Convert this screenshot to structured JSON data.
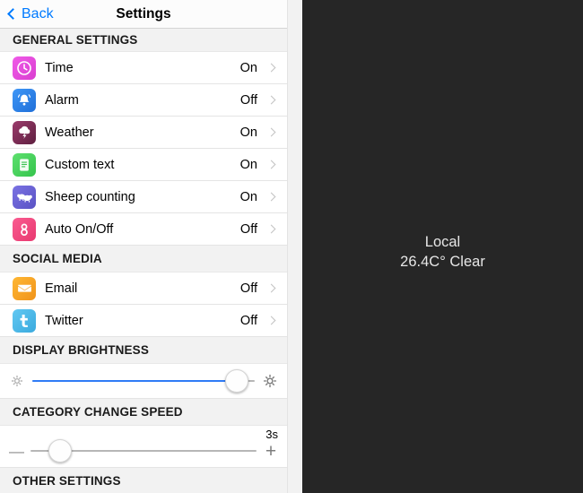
{
  "navbar": {
    "back_label": "Back",
    "title": "Settings",
    "back_icon": "chevron-left-icon",
    "accent_color": "#007aff"
  },
  "sections": [
    {
      "id": "general-settings",
      "header": "GENERAL SETTINGS",
      "rows": [
        {
          "label": "Time",
          "value": "On",
          "icon": "clock-icon",
          "icon_color": "#e94fe0"
        },
        {
          "label": "Alarm",
          "value": "Off",
          "icon": "bell-icon",
          "icon_color": "#2f86f0"
        },
        {
          "label": "Weather",
          "value": "On",
          "icon": "storm-cloud-icon",
          "icon_color": "#7b2b52"
        },
        {
          "label": "Custom text",
          "value": "On",
          "icon": "document-icon",
          "icon_color": "#4cd464"
        },
        {
          "label": "Sheep counting",
          "value": "On",
          "icon": "sheep-icon",
          "icon_color": "#6a63d6"
        },
        {
          "label": "Auto On/Off",
          "value": "Off",
          "icon": "power-loop-icon",
          "icon_color": "#f0497f"
        }
      ]
    },
    {
      "id": "social-media",
      "header": "SOCIAL MEDIA",
      "rows": [
        {
          "label": "Email",
          "value": "Off",
          "icon": "envelope-icon",
          "icon_color": "#f5a623"
        },
        {
          "label": "Twitter",
          "value": "Off",
          "icon": "twitter-bird-icon",
          "icon_color": "#4fbcea"
        }
      ]
    }
  ],
  "brightness": {
    "header": "DISPLAY BRIGHTNESS",
    "min_icon": "sun-small-icon",
    "max_icon": "sun-large-icon",
    "percent": 92,
    "fill_color": "#2f7bf6"
  },
  "category_speed": {
    "header": "CATEGORY CHANGE SPEED",
    "min_icon": "minus-icon",
    "max_icon": "plus-icon",
    "value_label": "3s",
    "percent": 13
  },
  "other_settings": {
    "header": "OTHER SETTINGS"
  },
  "preview": {
    "location": "Local",
    "conditions": "26.4C° Clear",
    "background_color": "#262626",
    "text_color": "#e6e6e6"
  }
}
